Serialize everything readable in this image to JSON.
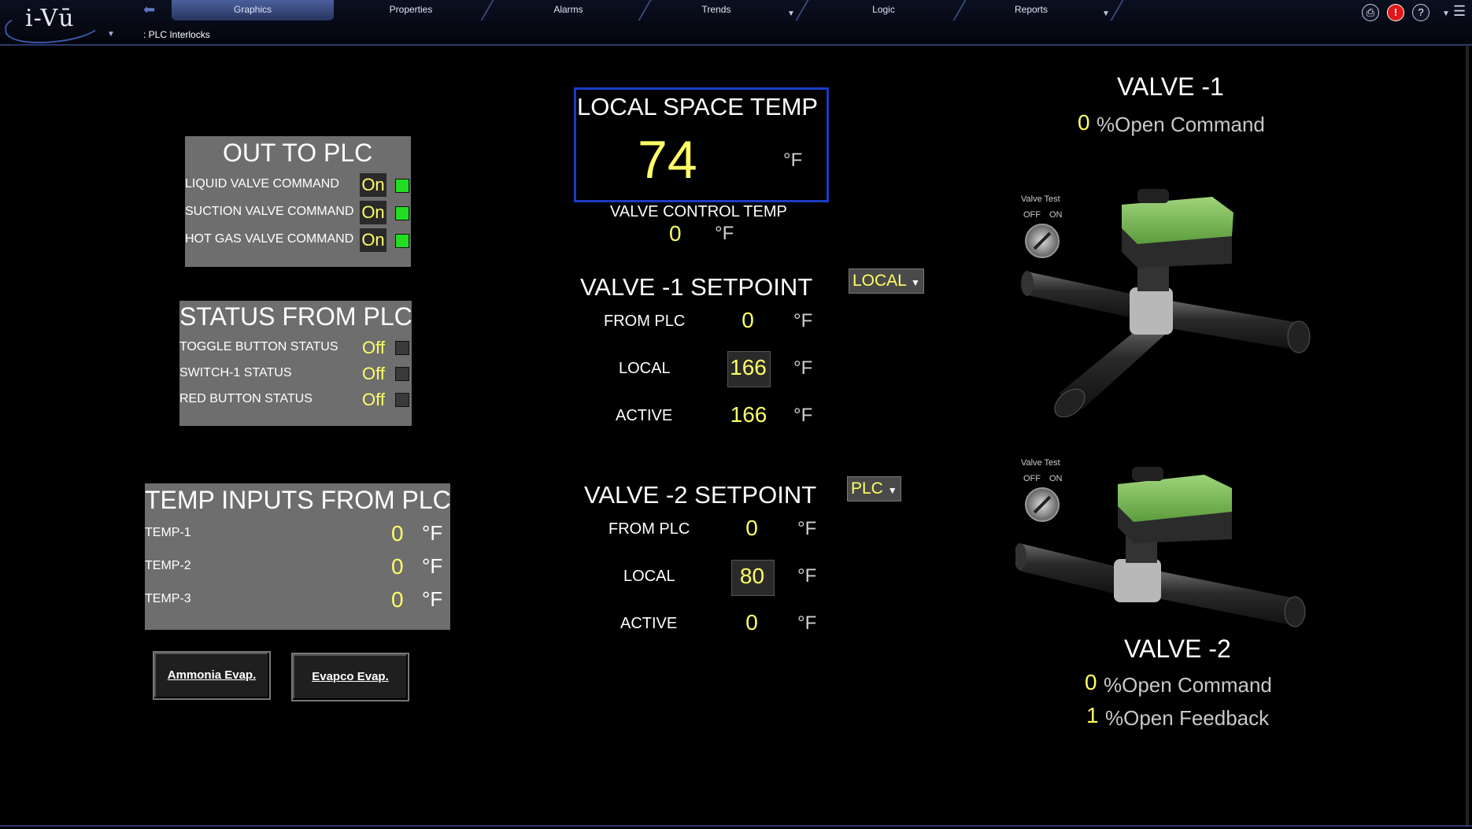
{
  "app": {
    "logo": "i-Vū"
  },
  "nav": {
    "tabs": [
      {
        "label": "Graphics"
      },
      {
        "label": "Properties"
      },
      {
        "label": "Alarms"
      },
      {
        "label": "Trends"
      },
      {
        "label": "Logic"
      },
      {
        "label": "Reports"
      }
    ],
    "breadcrumb": ": PLC Interlocks"
  },
  "out_to_plc": {
    "title": "OUT TO PLC",
    "rows": [
      {
        "label": "LIQUID VALVE COMMAND",
        "value": "On"
      },
      {
        "label": "SUCTION VALVE COMMAND",
        "value": "On"
      },
      {
        "label": "HOT GAS VALVE COMMAND",
        "value": "On"
      }
    ]
  },
  "status_from_plc": {
    "title": "STATUS FROM PLC",
    "rows": [
      {
        "label": "TOGGLE BUTTON STATUS",
        "value": "Off"
      },
      {
        "label": "SWITCH-1 STATUS",
        "value": "Off"
      },
      {
        "label": "RED BUTTON STATUS",
        "value": "Off"
      }
    ]
  },
  "temp_inputs": {
    "title": "TEMP INPUTS FROM PLC",
    "rows": [
      {
        "label": "TEMP-1",
        "value": "0",
        "unit": "°F"
      },
      {
        "label": "TEMP-2",
        "value": "0",
        "unit": "°F"
      },
      {
        "label": "TEMP-3",
        "value": "0",
        "unit": "°F"
      }
    ]
  },
  "buttons": {
    "ammonia": "Ammonia Evap.",
    "evapco": "Evapco Evap."
  },
  "local_space": {
    "title": "LOCAL SPACE TEMP",
    "value": "74",
    "unit": "°F"
  },
  "valve_control": {
    "title": "VALVE CONTROL TEMP",
    "value": "0",
    "unit": "°F"
  },
  "valve1_setpoint": {
    "title": "VALVE -1 SETPOINT",
    "mode": "LOCAL",
    "from_plc": {
      "label": "FROM PLC",
      "value": "0",
      "unit": "°F"
    },
    "local": {
      "label": "LOCAL",
      "value": "166",
      "unit": "°F"
    },
    "active": {
      "label": "ACTIVE",
      "value": "166",
      "unit": "°F"
    }
  },
  "valve2_setpoint": {
    "title": "VALVE -2 SETPOINT",
    "mode": "PLC",
    "from_plc": {
      "label": "FROM PLC",
      "value": "0",
      "unit": "°F"
    },
    "local": {
      "label": "LOCAL",
      "value": "80",
      "unit": "°F"
    },
    "active": {
      "label": "ACTIVE",
      "value": "0",
      "unit": "°F"
    }
  },
  "valve1": {
    "title": "VALVE -1",
    "cmd_value": "0",
    "cmd_label": "%Open Command",
    "test_label": "Valve Test",
    "off": "OFF",
    "on": "ON"
  },
  "valve2": {
    "title": "VALVE -2",
    "cmd_value": "0",
    "cmd_label": "%Open Command",
    "fb_value": "1",
    "fb_label": "%Open Feedback",
    "test_label": "Valve Test",
    "off": "OFF",
    "on": "ON"
  },
  "colors": {
    "accent_value": "#ffff66",
    "led_on": "#22dd22",
    "panel": "#6e6e6e",
    "highlight_border": "#1a3cc8"
  }
}
